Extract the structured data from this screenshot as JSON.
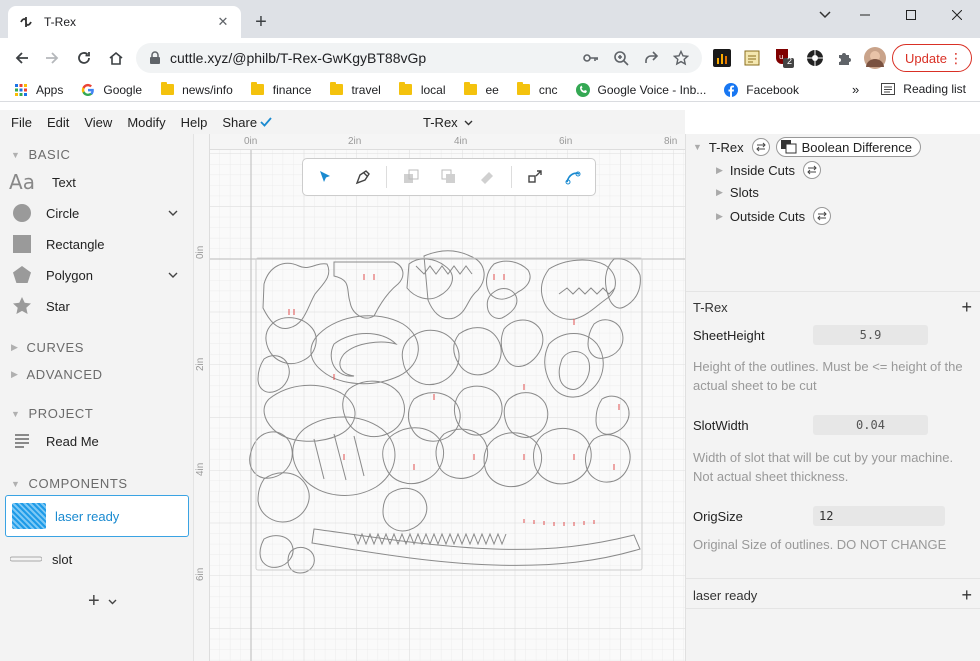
{
  "browser": {
    "tab_title": "T-Rex",
    "url": "cuttle.xyz/@philb/T-Rex-GwKgyBT88vGp",
    "update_label": "Update",
    "ext_badge": "2",
    "bookmarks": [
      "Apps",
      "Google",
      "news/info",
      "finance",
      "travel",
      "local",
      "ee",
      "cnc",
      "Google Voice - Inb...",
      "Facebook"
    ],
    "more_bookmarks": "»",
    "reading_list": "Reading list"
  },
  "menu": {
    "file": "File",
    "edit": "Edit",
    "view": "View",
    "modify": "Modify",
    "help": "Help",
    "share": "Share",
    "doc_title": "T-Rex"
  },
  "left": {
    "basic": "BASIC",
    "shapes": [
      "Text",
      "Circle",
      "Rectangle",
      "Polygon",
      "Star"
    ],
    "curves": "CURVES",
    "advanced": "ADVANCED",
    "project": "PROJECT",
    "read_me": "Read Me",
    "components": "COMPONENTS",
    "laser_ready": "laser ready",
    "slot": "slot"
  },
  "rulers": {
    "top": [
      "0in",
      "2in",
      "4in",
      "6in",
      "8in"
    ],
    "left": [
      "0in",
      "2in",
      "4in",
      "6in"
    ]
  },
  "tree": {
    "root": "T-Rex",
    "boolean": "Boolean Difference",
    "children": [
      "Inside Cuts",
      "Slots",
      "Outside Cuts"
    ]
  },
  "params": {
    "section": "T-Rex",
    "sheet_height_label": "SheetHeight",
    "sheet_height_value": "5.9",
    "sheet_height_desc": "Height of the outlines. Must be <= height of the actual sheet to be cut",
    "slot_width_label": "SlotWidth",
    "slot_width_value": "0.04",
    "slot_width_desc": "Width of slot that will be cut by your machine. Not actual sheet thickness.",
    "orig_size_label": "OrigSize",
    "orig_size_value": "12",
    "orig_size_desc": "Original Size of outlines.  DO NOT CHANGE",
    "laser_ready": "laser ready"
  },
  "colors": {
    "accent": "#1a8ad0",
    "update_red": "#d93025",
    "cut_line": "#888888",
    "slot_mark": "#e05050"
  }
}
